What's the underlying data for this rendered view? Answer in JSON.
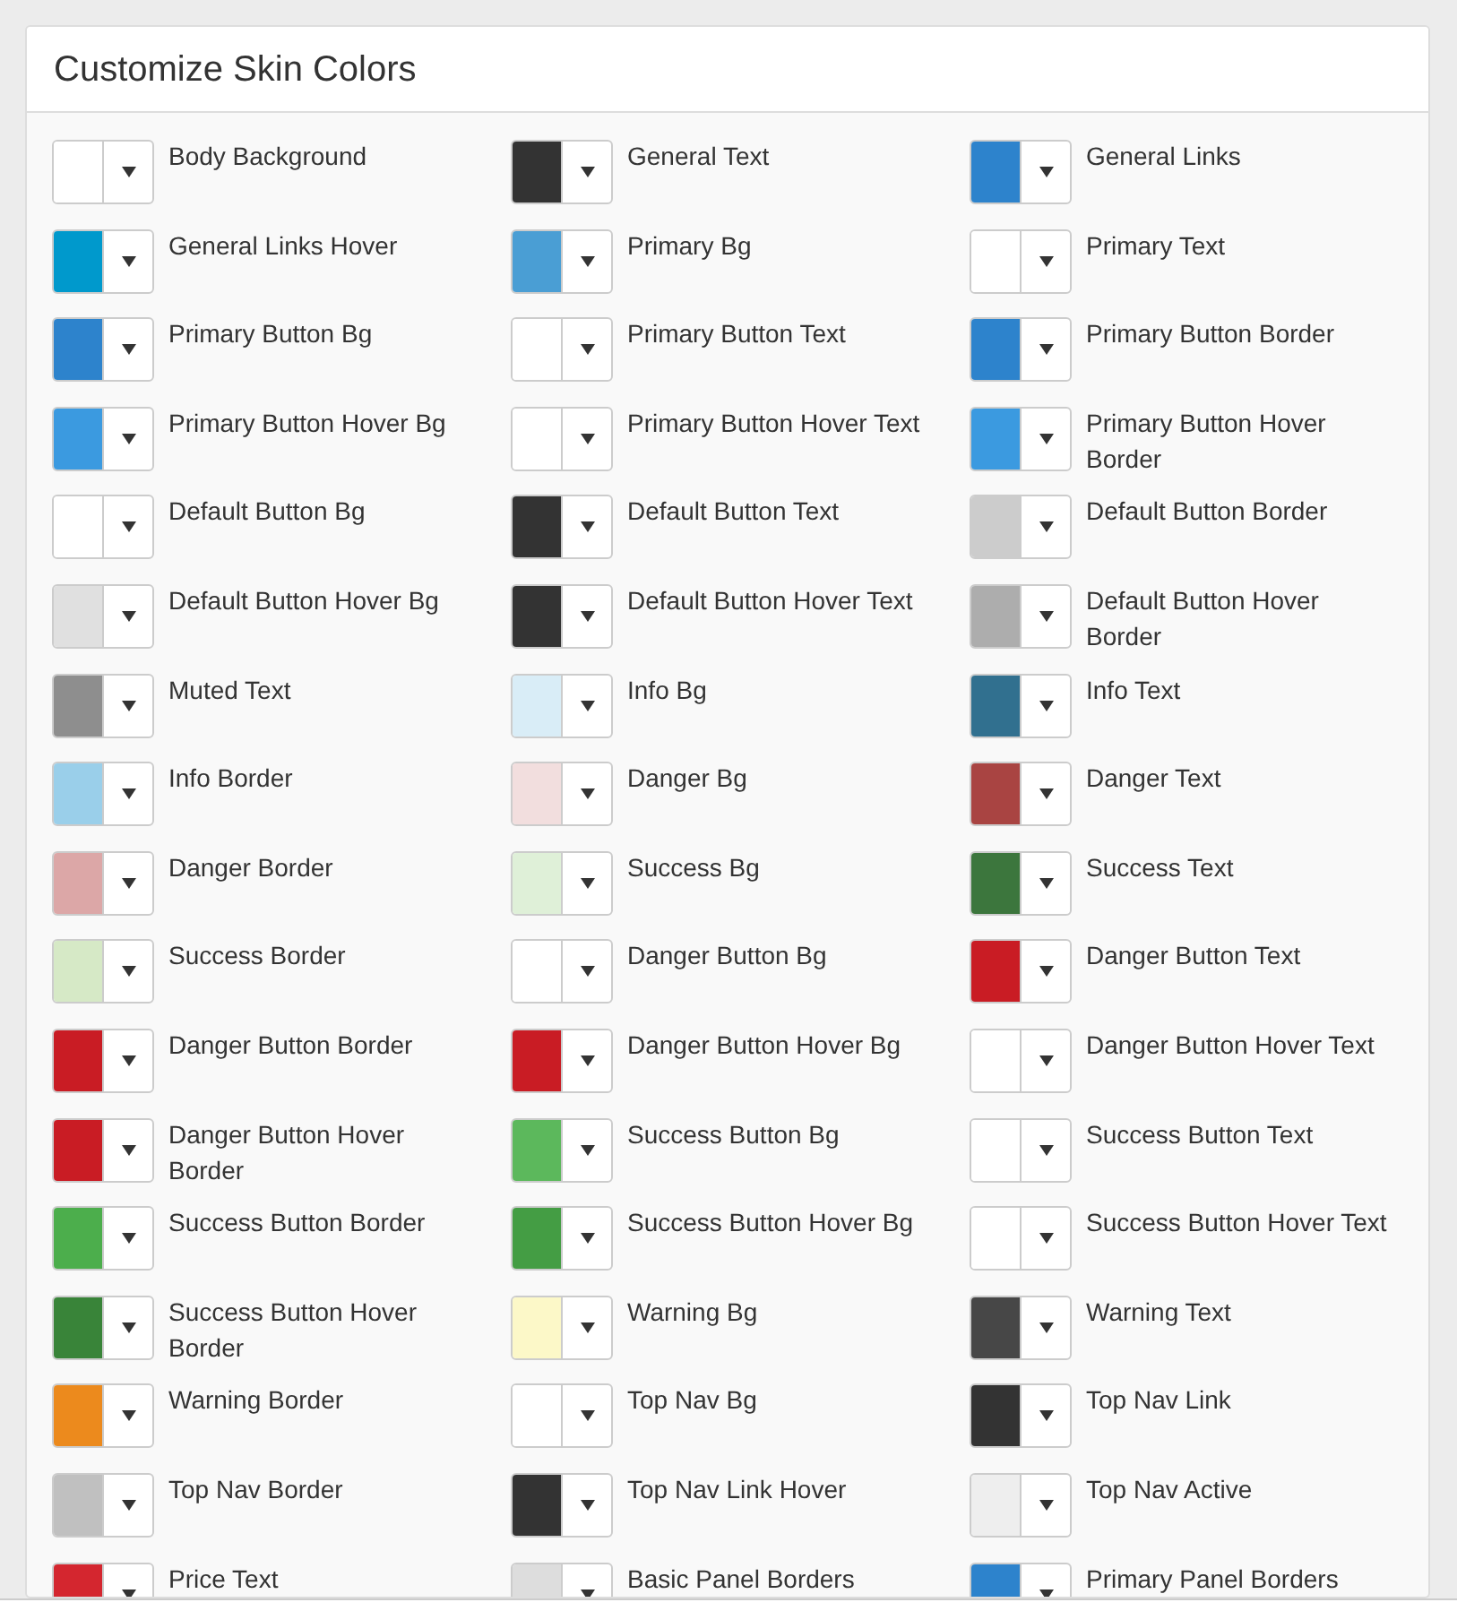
{
  "title": "Customize Skin Colors",
  "items": [
    {
      "label": "Body Background",
      "color": "#ffffff"
    },
    {
      "label": "General Text",
      "color": "#333333"
    },
    {
      "label": "General Links",
      "color": "#2d83cc"
    },
    {
      "label": "General Links Hover",
      "color": "#0099cc"
    },
    {
      "label": "Primary Bg",
      "color": "#4a9ed4"
    },
    {
      "label": "Primary Text",
      "color": "#ffffff"
    },
    {
      "label": "Primary Button Bg",
      "color": "#2d83cc"
    },
    {
      "label": "Primary Button Text",
      "color": "#ffffff"
    },
    {
      "label": "Primary Button Border",
      "color": "#2d83cc"
    },
    {
      "label": "Primary Button Hover Bg",
      "color": "#3b9ae0"
    },
    {
      "label": "Primary Button Hover Text",
      "color": "#ffffff"
    },
    {
      "label": "Primary Button Hover Border",
      "color": "#3b9ae0"
    },
    {
      "label": "Default Button Bg",
      "color": "#ffffff"
    },
    {
      "label": "Default Button Text",
      "color": "#333333"
    },
    {
      "label": "Default Button Border",
      "color": "#cccccc"
    },
    {
      "label": "Default Button Hover Bg",
      "color": "#e0e0e0"
    },
    {
      "label": "Default Button Hover Text",
      "color": "#333333"
    },
    {
      "label": "Default Button Hover Border",
      "color": "#adadad"
    },
    {
      "label": "Muted Text",
      "color": "#8e8e8e"
    },
    {
      "label": "Info Bg",
      "color": "#d9edf7"
    },
    {
      "label": "Info Text",
      "color": "#31708f"
    },
    {
      "label": "Info Border",
      "color": "#9acfea"
    },
    {
      "label": "Danger Bg",
      "color": "#f2dede"
    },
    {
      "label": "Danger Text",
      "color": "#a94442"
    },
    {
      "label": "Danger Border",
      "color": "#dca7a7"
    },
    {
      "label": "Success Bg",
      "color": "#dff0d8"
    },
    {
      "label": "Success Text",
      "color": "#3c763d"
    },
    {
      "label": "Success Border",
      "color": "#d6e9c6"
    },
    {
      "label": "Danger Button Bg",
      "color": "#ffffff"
    },
    {
      "label": "Danger Button Text",
      "color": "#c91c24"
    },
    {
      "label": "Danger Button Border",
      "color": "#c91c24"
    },
    {
      "label": "Danger Button Hover Bg",
      "color": "#c91c24"
    },
    {
      "label": "Danger Button Hover Text",
      "color": "#ffffff"
    },
    {
      "label": "Danger Button Hover Border",
      "color": "#c91c24"
    },
    {
      "label": "Success Button Bg",
      "color": "#5cb85c"
    },
    {
      "label": "Success Button Text",
      "color": "#ffffff"
    },
    {
      "label": "Success Button Border",
      "color": "#4cae4c"
    },
    {
      "label": "Success Button Hover Bg",
      "color": "#449d44"
    },
    {
      "label": "Success Button Hover Text",
      "color": "#ffffff"
    },
    {
      "label": "Success Button Hover Border",
      "color": "#398439"
    },
    {
      "label": "Warning Bg",
      "color": "#fcf8c8"
    },
    {
      "label": "Warning Text",
      "color": "#474747"
    },
    {
      "label": "Warning Border",
      "color": "#ec8a1d"
    },
    {
      "label": "Top Nav Bg",
      "color": "#ffffff"
    },
    {
      "label": "Top Nav Link",
      "color": "#333333"
    },
    {
      "label": "Top Nav Border",
      "color": "#c0c0c0"
    },
    {
      "label": "Top Nav Link Hover",
      "color": "#333333"
    },
    {
      "label": "Top Nav Active",
      "color": "#eeeeee"
    },
    {
      "label": "Price Text",
      "color": "#d4262f"
    },
    {
      "label": "Basic Panel Borders",
      "color": "#dddddd"
    },
    {
      "label": "Primary Panel Borders",
      "color": "#2d83cc"
    }
  ]
}
